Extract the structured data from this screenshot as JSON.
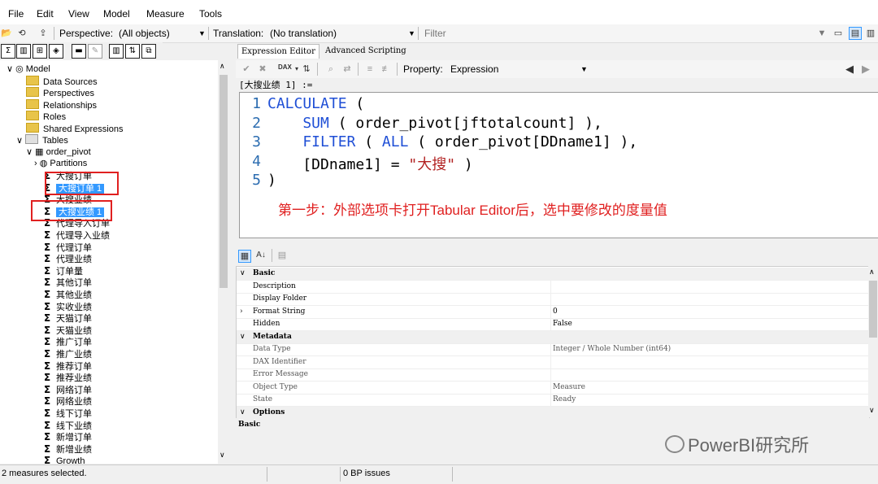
{
  "menu": [
    "File",
    "Edit",
    "View",
    "Model",
    "Measure",
    "Tools"
  ],
  "toolbar1": {
    "perspective_label": "Perspective:",
    "perspective_value": "(All objects)",
    "translation_label": "Translation:",
    "translation_value": "(No translation)",
    "filter_placeholder": "Filter"
  },
  "editor_tabs": [
    "Expression Editor",
    "Advanced Scripting"
  ],
  "editor_toolbar": {
    "property_label": "Property:",
    "property_value": "Expression",
    "dax_label": "DAX"
  },
  "tree": {
    "model": "Model",
    "folders": [
      "Data Sources",
      "Perspectives",
      "Relationships",
      "Roles",
      "Shared Expressions"
    ],
    "tables": "Tables",
    "table": "order_pivot",
    "partitions": "Partitions",
    "measures": [
      "大搜订单",
      "大搜订单 1",
      "大搜业绩",
      "大搜业绩 1",
      "代理导入订单",
      "代理导入业绩",
      "代理订单",
      "代理业绩",
      "订单量",
      "其他订单",
      "其他业绩",
      "实收业绩",
      "天猫订单",
      "天猫业绩",
      "推广订单",
      "推广业绩",
      "推荐订单",
      "推荐业绩",
      "网络订单",
      "网络业绩",
      "线下订单",
      "线下业绩",
      "新增订单",
      "新增业绩",
      "Growth"
    ]
  },
  "expression": {
    "header": "[大搜业绩 1] :=",
    "lines": [
      {
        "n": "1",
        "parts": [
          {
            "t": "CALCULATE",
            "c": "kw"
          },
          {
            "t": " (",
            "c": ""
          }
        ]
      },
      {
        "n": "2",
        "parts": [
          {
            "t": "    SUM",
            "c": "kw"
          },
          {
            "t": " ( order_pivot[jftotalcount] ),",
            "c": ""
          }
        ]
      },
      {
        "n": "3",
        "parts": [
          {
            "t": "    FILTER",
            "c": "kw"
          },
          {
            "t": " ( ",
            "c": ""
          },
          {
            "t": "ALL",
            "c": "kw"
          },
          {
            "t": " ( order_pivot[DDname1] ),",
            "c": ""
          }
        ]
      },
      {
        "n": "4",
        "parts": [
          {
            "t": "    [DDname1] = ",
            "c": ""
          },
          {
            "t": "\"大搜\"",
            "c": "str"
          },
          {
            "t": " )",
            "c": ""
          }
        ]
      },
      {
        "n": "5",
        "parts": [
          {
            "t": ")",
            "c": ""
          }
        ]
      }
    ],
    "annotation": "第一步：外部选项卡打开Tabular Editor后，选中要修改的度量值"
  },
  "properties": {
    "rows": [
      {
        "name": "Basic",
        "value": "",
        "kind": "cat",
        "toggle": "∨"
      },
      {
        "name": "Description",
        "value": "",
        "kind": "prop",
        "toggle": ""
      },
      {
        "name": "Display Folder",
        "value": "",
        "kind": "prop",
        "toggle": ""
      },
      {
        "name": "Format String",
        "value": "0",
        "kind": "prop",
        "toggle": "›"
      },
      {
        "name": "Hidden",
        "value": "False",
        "kind": "prop",
        "toggle": ""
      },
      {
        "name": "Metadata",
        "value": "",
        "kind": "cat",
        "toggle": "∨"
      },
      {
        "name": "Data Type",
        "value": "Integer / Whole Number (int64)",
        "kind": "muted",
        "toggle": ""
      },
      {
        "name": "DAX Identifier",
        "value": "",
        "kind": "muted",
        "toggle": ""
      },
      {
        "name": "Error Message",
        "value": "",
        "kind": "muted",
        "toggle": ""
      },
      {
        "name": "Object Type",
        "value": "Measure",
        "kind": "muted",
        "toggle": ""
      },
      {
        "name": "State",
        "value": "Ready",
        "kind": "muted",
        "toggle": ""
      },
      {
        "name": "Options",
        "value": "",
        "kind": "cat",
        "toggle": "∨"
      }
    ],
    "description_title": "Basic"
  },
  "status": {
    "left": "2 measures selected.",
    "mid": "0 BP issues"
  },
  "watermark": "PowerBI研究所",
  "colors": {
    "selection": "#3399ff",
    "annotation": "#e02020",
    "keyword": "#1f4fd6"
  }
}
